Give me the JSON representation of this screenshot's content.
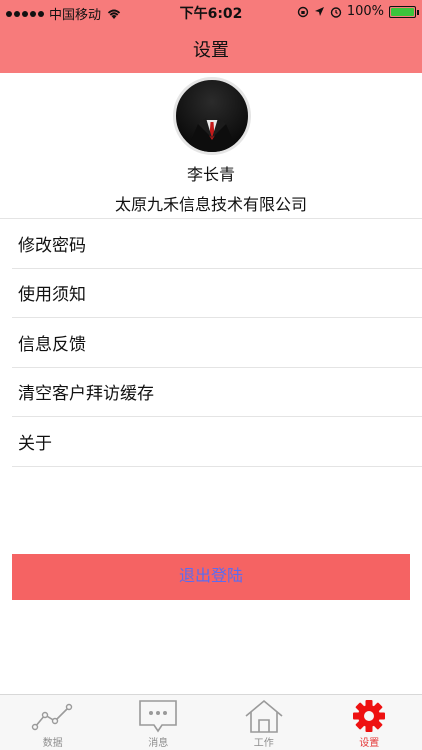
{
  "status_bar": {
    "carrier": "中国移动",
    "time": "下午6:02",
    "battery": "100%"
  },
  "header": {
    "title": "设置"
  },
  "profile": {
    "name": "李长青",
    "company": "太原九禾信息技术有限公司"
  },
  "menu": [
    {
      "label": "修改密码"
    },
    {
      "label": "使用须知"
    },
    {
      "label": "信息反馈"
    },
    {
      "label": "清空客户拜访缓存"
    },
    {
      "label": "关于"
    }
  ],
  "logout_label": "退出登陆",
  "tabs": [
    {
      "label": "数据",
      "icon": "chart-line-icon"
    },
    {
      "label": "消息",
      "icon": "message-icon"
    },
    {
      "label": "工作",
      "icon": "home-icon"
    },
    {
      "label": "设置",
      "icon": "gear-icon",
      "active": true
    }
  ],
  "colors": {
    "header": "#f77b7b",
    "logout_bg": "#f56363",
    "logout_text": "#5b6cf0",
    "active_tab": "#e53a3a"
  }
}
